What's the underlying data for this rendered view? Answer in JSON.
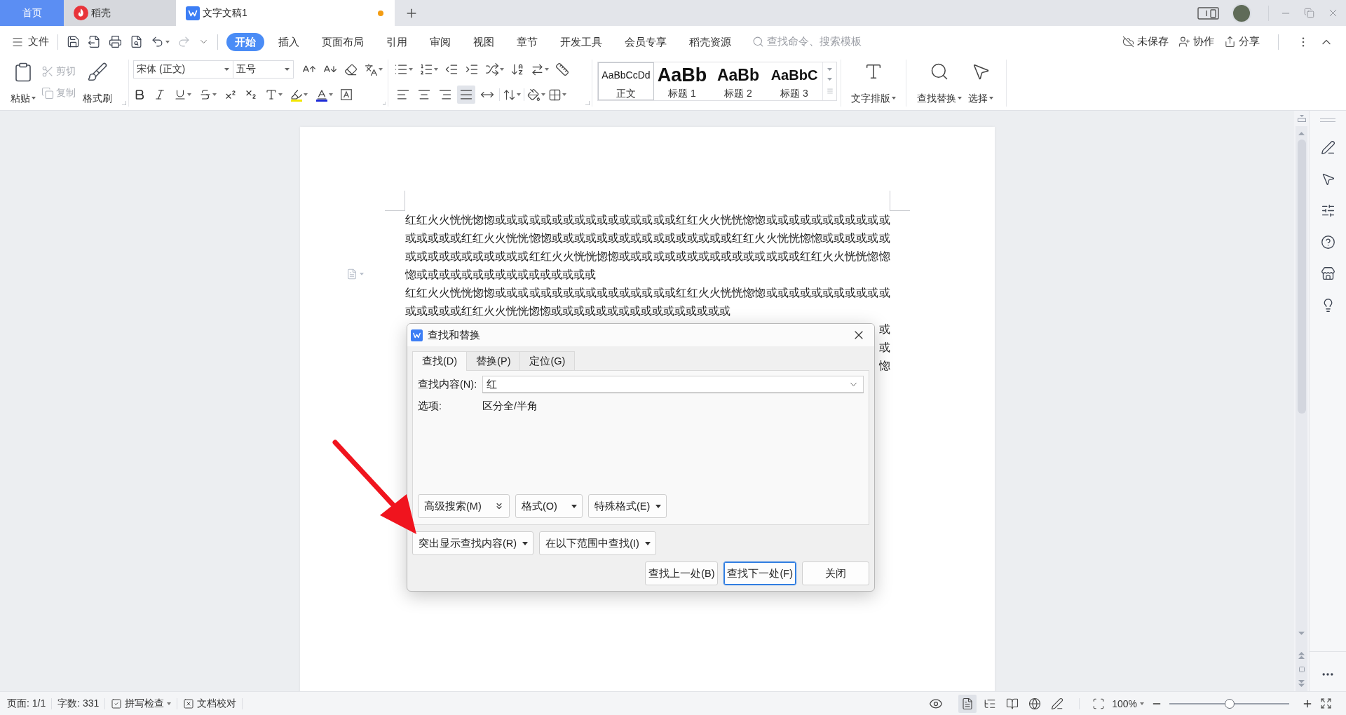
{
  "tab_bar": {
    "tabs": [
      {
        "label": "首页",
        "kind": "home",
        "selected": false
      },
      {
        "label": "稻壳",
        "kind": "docer",
        "selected": false
      },
      {
        "label": "文字文稿1",
        "kind": "writer",
        "selected": true,
        "modified": true
      }
    ]
  },
  "menu_bar": {
    "file": "文件",
    "tabs": [
      {
        "label": "开始",
        "selected": true
      },
      {
        "label": "插入",
        "selected": false
      },
      {
        "label": "页面布局",
        "selected": false
      },
      {
        "label": "引用",
        "selected": false
      },
      {
        "label": "审阅",
        "selected": false
      },
      {
        "label": "视图",
        "selected": false
      },
      {
        "label": "章节",
        "selected": false
      },
      {
        "label": "开发工具",
        "selected": false
      },
      {
        "label": "会员专享",
        "selected": false
      },
      {
        "label": "稻壳资源",
        "selected": false
      }
    ],
    "search": {
      "placeholder": "查找命令、搜索模板"
    },
    "actions": [
      {
        "label": "未保存",
        "kind": "cloud"
      },
      {
        "label": "协作",
        "kind": "collaborate"
      },
      {
        "label": "分享",
        "kind": "share"
      }
    ]
  },
  "ribbon": {
    "clipboard": {
      "paste": "粘贴",
      "cut": {
        "label": "剪切",
        "disabled": true
      },
      "copy": {
        "label": "复制",
        "disabled": true
      },
      "format_painter": "格式刷"
    },
    "font": {
      "name": "宋体 (正文)",
      "size": "五号"
    },
    "alignment": [
      {
        "kind": "left",
        "selected": false
      },
      {
        "kind": "center",
        "selected": false
      },
      {
        "kind": "right",
        "selected": false
      },
      {
        "kind": "justify",
        "selected": true
      },
      {
        "kind": "distribute",
        "selected": false
      }
    ],
    "styles": [
      {
        "preview": "AaBbCcDd",
        "label": "正文",
        "kind": "body",
        "selected": true
      },
      {
        "preview": "AaBb",
        "label": "标题 1",
        "kind": "heading1",
        "selected": false
      },
      {
        "preview": "AaBb",
        "label": "标题 2",
        "kind": "heading2",
        "selected": false
      },
      {
        "preview": "AaBbC",
        "label": "标题 3",
        "kind": "heading3",
        "selected": false
      }
    ],
    "tools": [
      {
        "label": "文字排版",
        "kind": "text-layout"
      },
      {
        "label": "查找替换",
        "kind": "find-replace"
      },
      {
        "label": "选择",
        "kind": "select"
      }
    ]
  },
  "document": {
    "paragraphs": [
      "红红火火恍恍惚惚或或或或或或或或或或或或或或或或红红火火恍恍惚惚或或或或或或或或或或或或或或或或红红火火恍恍惚惚或或或或或或或或或或或或或或或或红红火火恍恍惚惚或或或或或或或或或或或或或或或或或红红火火恍恍惚惚或或或或或或或或或或或或或或或或红红火火恍恍惚惚惚或或或或或或或或或或或或或或或或",
      "红红火火恍恍惚惚或或或或或或或或或或或或或或或或红红火火恍恍惚惚或或或或或或或或或或或或或或或或红红火火恍恍惚惚或或或或或或或或或或或或或或或或"
    ],
    "covered_paragraph": {
      "line_ends": [
        "或",
        "或",
        "惚"
      ]
    }
  },
  "dialog": {
    "title": "查找和替换",
    "tabs": [
      {
        "label": "查找(D)",
        "selected": true
      },
      {
        "label": "替换(P)",
        "selected": false
      },
      {
        "label": "定位(G)",
        "selected": false
      }
    ],
    "find": {
      "label": "查找内容(N):",
      "value": "红"
    },
    "options": {
      "label": "选项:",
      "value": "区分全/半角"
    },
    "search_buttons": [
      {
        "label": "高级搜索(M)",
        "kind": "expand"
      },
      {
        "label": "格式(O)",
        "kind": "menu"
      },
      {
        "label": "特殊格式(E)",
        "kind": "menu"
      }
    ],
    "highlight_buttons": [
      {
        "label": "突出显示查找内容(R)",
        "kind": "menu"
      },
      {
        "label": "在以下范围中查找(I)",
        "kind": "menu"
      }
    ],
    "actions": [
      {
        "label": "查找上一处(B)",
        "focused": false
      },
      {
        "label": "查找下一处(F)",
        "focused": true
      },
      {
        "label": "关闭",
        "focused": false
      }
    ]
  },
  "status_bar": {
    "page": "页面: 1/1",
    "word_count": "字数: 331",
    "spell_check": "拼写检查",
    "proofread": "文档校对",
    "view_modes": [
      {
        "kind": "page",
        "selected": true
      },
      {
        "kind": "outline",
        "selected": false
      },
      {
        "kind": "reading",
        "selected": false
      },
      {
        "kind": "web",
        "selected": false
      },
      {
        "kind": "writing",
        "selected": false
      }
    ],
    "zoom": {
      "label": "100%",
      "level": 0.5
    }
  }
}
